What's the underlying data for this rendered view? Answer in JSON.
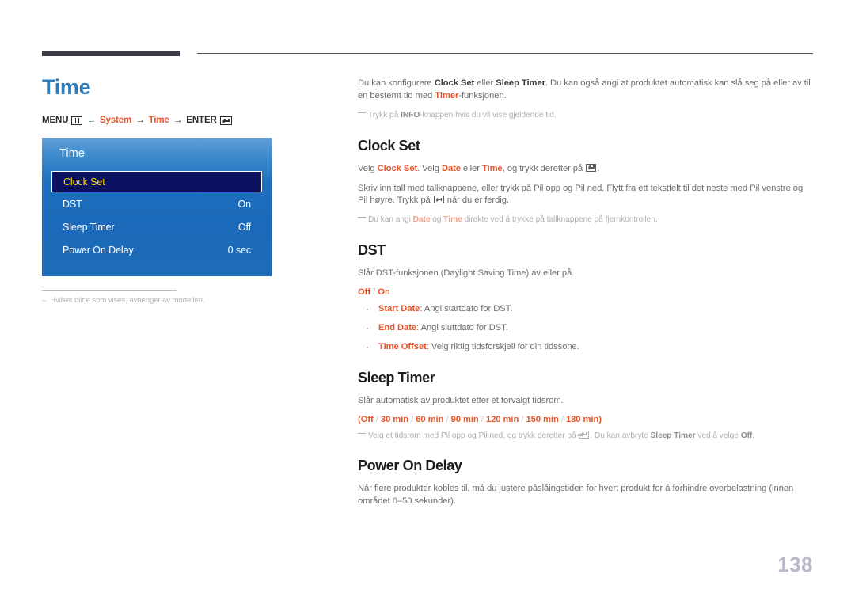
{
  "page": {
    "number": "138",
    "title": "Time",
    "accent_color": "#e8542a",
    "title_color": "#2f7cb9"
  },
  "menu_path": {
    "menu_label": "MENU",
    "menu_icon": "menu-bars-icon",
    "arrow1": "→",
    "system_label": "System",
    "arrow2": "→",
    "time_label": "Time",
    "arrow3": "→",
    "enter_label": "ENTER",
    "enter_icon": "enter-key-icon"
  },
  "osd": {
    "title": "Time",
    "rows": [
      {
        "label": "Clock Set",
        "value": "",
        "selected": true
      },
      {
        "label": "DST",
        "value": "On",
        "selected": false
      },
      {
        "label": "Sleep Timer",
        "value": "Off",
        "selected": false
      },
      {
        "label": "Power On Delay",
        "value": "0 sec",
        "selected": false
      }
    ]
  },
  "left_note": {
    "dash": "–",
    "text": "Hvilket bilde som vises, avhenger av modellen."
  },
  "intro": {
    "p1_a": "Du kan konfigurere ",
    "p1_b": "Clock Set",
    "p1_c": " eller ",
    "p1_d": "Sleep Timer",
    "p1_e": ". Du kan også angi at produktet automatisk kan slå seg på eller av til en bestemt tid med ",
    "p1_f": "Timer",
    "p1_g": "-funksjonen.",
    "note_a": "Trykk på ",
    "note_b": "INFO",
    "note_c": "-knappen hvis du vil vise gjeldende tid."
  },
  "clock_set": {
    "heading": "Clock Set",
    "p1_a": "Velg ",
    "p1_b": "Clock Set",
    "p1_c": ". Velg ",
    "p1_d": "Date",
    "p1_e": " eller ",
    "p1_f": "Time",
    "p1_g": ", og trykk deretter på ",
    "p1_h": ".",
    "p2_a": "Skriv inn tall med tallknappene, eller trykk på Pil opp og Pil ned. Flytt fra ett tekstfelt til det neste med Pil venstre og Pil høyre. Trykk på ",
    "p2_b": " når du er ferdig.",
    "note_a": "Du kan angi ",
    "note_b": "Date",
    "note_c": " og ",
    "note_d": "Time",
    "note_e": " direkte ved å trykke på tallknappene på fjernkontrollen."
  },
  "dst": {
    "heading": "DST",
    "p1": "Slår DST-funksjonen (Daylight Saving Time) av eller på.",
    "options_a": "Off",
    "options_sep": " / ",
    "options_b": "On",
    "bullets": [
      {
        "term": "Start Date",
        "desc": ": Angi startdato for DST."
      },
      {
        "term": "End Date",
        "desc": ": Angi sluttdato for DST."
      },
      {
        "term": "Time Offset",
        "desc": ": Velg riktig tidsforskjell for din tidssone."
      }
    ]
  },
  "sleep_timer": {
    "heading": "Sleep Timer",
    "p1": "Slår automatisk av produktet etter et forvalgt tidsrom.",
    "open_paren": "(",
    "options": [
      "Off",
      "30 min",
      "60 min",
      "90 min",
      "120 min",
      "150 min",
      "180 min"
    ],
    "option_sep": " / ",
    "close_paren": ")",
    "note_a": "Velg et tidsrom med Pil opp og Pil ned, og trykk deretter på ",
    "note_b": ". Du kan avbryte ",
    "note_c": "Sleep Timer",
    "note_d": " ved å velge ",
    "note_e": "Off",
    "note_f": "."
  },
  "power_on_delay": {
    "heading": "Power On Delay",
    "p1": "Når flere produkter kobles til, må du justere påslåingstiden for hvert produkt for å forhindre overbelastning (innen området 0–50 sekunder)."
  }
}
